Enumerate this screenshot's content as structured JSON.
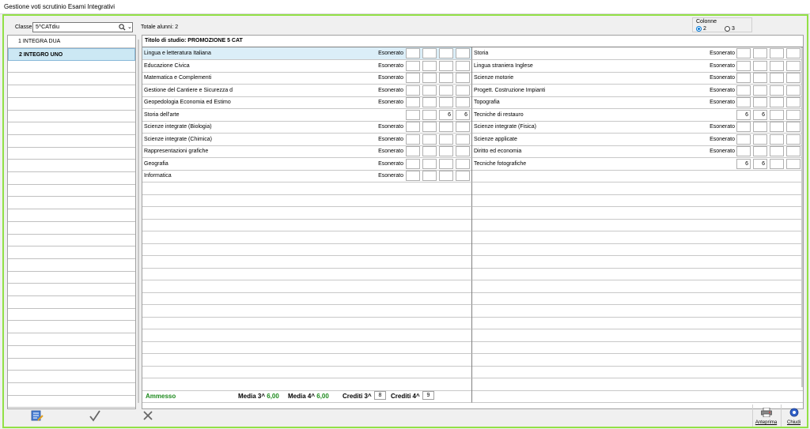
{
  "window": {
    "title": "Gestione voti scrutinio Esami Integrativi"
  },
  "toolbar": {
    "classe_label": "Classe",
    "classe_value": "5^CATdiu",
    "totale": "Totale alunni: 2",
    "colonne_label": "Colonne",
    "colonne_options": [
      "2",
      "3"
    ],
    "colonne_selected": "2"
  },
  "students": [
    {
      "num": "1",
      "name": "INTEGRA DUA",
      "selected": false
    },
    {
      "num": "2",
      "name": "INTEGRO UNO",
      "selected": true
    }
  ],
  "grid": {
    "title": "Titolo di studio:  PROMOZIONE 5 CAT",
    "left": [
      {
        "subject": "Lingua e letteratura Italiana",
        "status": "Esonerato",
        "c1": "",
        "c2": "",
        "c3": "",
        "c4": ""
      },
      {
        "subject": "Educazione Civica",
        "status": "Esonerato",
        "c1": "",
        "c2": "",
        "c3": "",
        "c4": ""
      },
      {
        "subject": "Matematica e Complementi",
        "status": "Esonerato",
        "c1": "",
        "c2": "",
        "c3": "",
        "c4": ""
      },
      {
        "subject": "Gestione del Cantiere e Sicurezza d",
        "status": "Esonerato",
        "c1": "",
        "c2": "",
        "c3": "",
        "c4": ""
      },
      {
        "subject": "Geopedologia Economia ed Estimo",
        "status": "Esonerato",
        "c1": "",
        "c2": "",
        "c3": "",
        "c4": ""
      },
      {
        "subject": "Storia dell'arte",
        "status": "",
        "c1": "",
        "c2": "",
        "c3": "6",
        "c4": "6"
      },
      {
        "subject": "Scienze integrate (Biologia)",
        "status": "Esonerato",
        "c1": "",
        "c2": "",
        "c3": "",
        "c4": ""
      },
      {
        "subject": "Scienze integrate (Chimica)",
        "status": "Esonerato",
        "c1": "",
        "c2": "",
        "c3": "",
        "c4": ""
      },
      {
        "subject": "Rappresentazioni grafiche",
        "status": "Esonerato",
        "c1": "",
        "c2": "",
        "c3": "",
        "c4": ""
      },
      {
        "subject": "Geografia",
        "status": "Esonerato",
        "c1": "",
        "c2": "",
        "c3": "",
        "c4": ""
      },
      {
        "subject": "Informatica",
        "status": "Esonerato",
        "c1": "",
        "c2": "",
        "c3": "",
        "c4": ""
      }
    ],
    "right": [
      {
        "subject": "Storia",
        "status": "Esonerato",
        "c1": "",
        "c2": "",
        "c3": "",
        "c4": ""
      },
      {
        "subject": "Lingua straniera Inglese",
        "status": "Esonerato",
        "c1": "",
        "c2": "",
        "c3": "",
        "c4": ""
      },
      {
        "subject": "Scienze motorie",
        "status": "Esonerato",
        "c1": "",
        "c2": "",
        "c3": "",
        "c4": ""
      },
      {
        "subject": "Progett. Costruzione Impianti",
        "status": "Esonerato",
        "c1": "",
        "c2": "",
        "c3": "",
        "c4": ""
      },
      {
        "subject": "Topografia",
        "status": "Esonerato",
        "c1": "",
        "c2": "",
        "c3": "",
        "c4": ""
      },
      {
        "subject": "Tecniche di restauro",
        "status": "",
        "c1": "6",
        "c2": "6",
        "c3": "",
        "c4": ""
      },
      {
        "subject": "Scienze integrate (Fisica)",
        "status": "Esonerato",
        "c1": "",
        "c2": "",
        "c3": "",
        "c4": ""
      },
      {
        "subject": "Scienze applicate",
        "status": "Esonerato",
        "c1": "",
        "c2": "",
        "c3": "",
        "c4": ""
      },
      {
        "subject": "Diritto ed economia",
        "status": "Esonerato",
        "c1": "",
        "c2": "",
        "c3": "",
        "c4": ""
      },
      {
        "subject": "Tecniche fotografiche",
        "status": "",
        "c1": "6",
        "c2": "6",
        "c3": "",
        "c4": ""
      }
    ]
  },
  "status": {
    "esito": "Ammesso",
    "media3_label": "Media 3^",
    "media3_value": "6,00",
    "media4_label": "Media 4^",
    "media4_value": "6,00",
    "crediti3_label": "Crediti 3^",
    "crediti3_value": "8",
    "crediti4_label": "Crediti 4^",
    "crediti4_value": "9"
  },
  "buttons": {
    "anteprima": "Anteprima",
    "chiudi": "Chiudi"
  },
  "icons": {
    "edit": "edit-icon",
    "confirm": "check-icon",
    "cancel": "cancel-icon",
    "preview": "printer-icon",
    "close": "close-icon"
  }
}
